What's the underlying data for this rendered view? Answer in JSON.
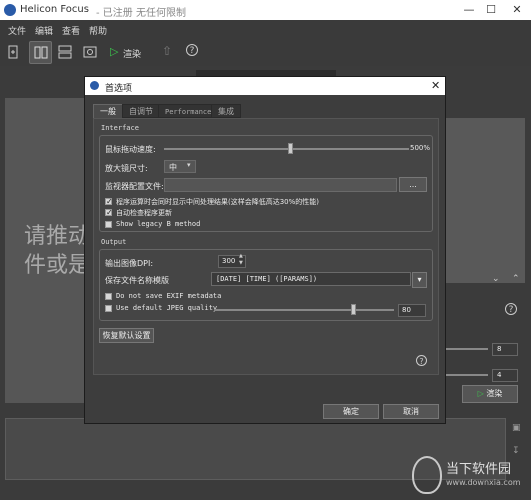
{
  "window": {
    "title": "Helicon Focus",
    "registration": "- 已注册  无任何限制",
    "minimize": "—",
    "maximize": "☐",
    "close": "✕"
  },
  "menu": [
    "文件",
    "编辑",
    "查看",
    "帮助"
  ],
  "toolbar": {
    "render_label": "渲染"
  },
  "background": {
    "drop_text_line1": "请推动",
    "drop_text_line2": "件或是",
    "spin_a": "8",
    "spin_b": "4",
    "render_label": "渲染"
  },
  "dialog": {
    "title": "首选项",
    "tabs": [
      "一般",
      "自调节",
      "Performance",
      "集成"
    ],
    "interface": {
      "group_label": "Interface",
      "mouse_speed_label": "鼠标拖动速度:",
      "mouse_speed_value": "500%",
      "mouse_speed_level": 0.52,
      "magnifier_label": "放大镜尺寸:",
      "magnifier_value": "中",
      "monitor_profile_label": "监视器配置文件:",
      "monitor_profile_value": "",
      "browse_label": "...",
      "show_intermediate_label": "程序运算时会同时显示中间处理结果(这样会降低高达30%的性能)",
      "show_intermediate_checked": true,
      "auto_update_label": "自动检查程序更新",
      "auto_update_checked": true,
      "legacy_b_label": "Show legacy B method",
      "legacy_b_checked": false
    },
    "output": {
      "group_label": "Output",
      "dpi_label": "输出图像DPI:",
      "dpi_value": "300",
      "template_label": "保存文件名称模版",
      "template_value": "[DATE] [TIME] ([PARAMS])",
      "exif_label": "Do not save EXIF metadata",
      "exif_checked": false,
      "jpeg_label": "Use default JPEG quality",
      "jpeg_checked": false,
      "jpeg_quality_value": "80",
      "jpeg_quality_level": 0.78
    },
    "restore_defaults_label": "恢复默认设置",
    "help_icon": "?",
    "ok_label": "确定",
    "cancel_label": "取消"
  },
  "watermark": {
    "brand": "当下软件园",
    "url": "www.downxia.com"
  }
}
